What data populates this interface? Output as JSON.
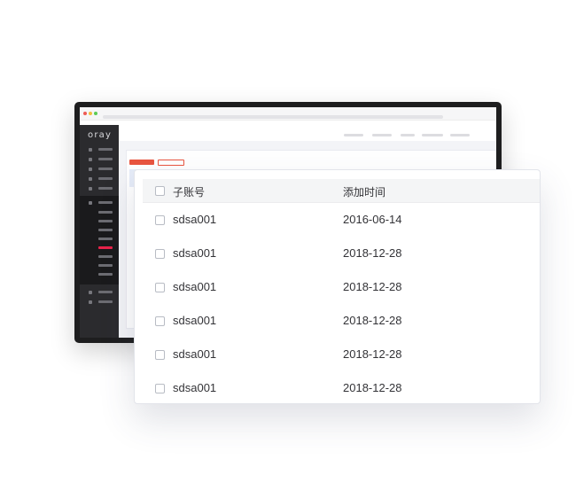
{
  "background_app": {
    "logo": "oray",
    "accent_color": "#e9553f",
    "active_menu_color": "#e8234a"
  },
  "table": {
    "headers": {
      "account": "子账号",
      "added_time": "添加时间"
    },
    "rows": [
      {
        "account": "sdsa001",
        "added_time": "2016-06-14"
      },
      {
        "account": "sdsa001",
        "added_time": "2018-12-28"
      },
      {
        "account": "sdsa001",
        "added_time": "2018-12-28"
      },
      {
        "account": "sdsa001",
        "added_time": "2018-12-28"
      },
      {
        "account": "sdsa001",
        "added_time": "2018-12-28"
      },
      {
        "account": "sdsa001",
        "added_time": "2018-12-28"
      }
    ]
  }
}
